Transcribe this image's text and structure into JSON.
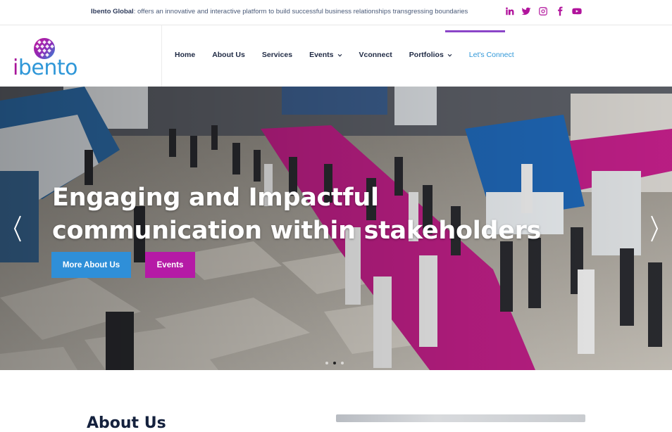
{
  "topbar": {
    "brand": "Ibento Global",
    "tagline": ": offers an innovative and interactive platform to build successful business relationships transgressing boundaries",
    "socials": [
      "linkedin-icon",
      "twitter-icon",
      "instagram-icon",
      "facebook-icon",
      "youtube-icon"
    ],
    "social_color": "#b1139c"
  },
  "logo": {
    "text_i": "i",
    "text_rest": "bento"
  },
  "nav": {
    "items": [
      {
        "label": "Home",
        "dropdown": false
      },
      {
        "label": "About Us",
        "dropdown": false
      },
      {
        "label": "Services",
        "dropdown": false
      },
      {
        "label": "Events",
        "dropdown": true
      },
      {
        "label": "Vconnect",
        "dropdown": false
      },
      {
        "label": "Portfolios",
        "dropdown": true
      },
      {
        "label": "Let's Connect",
        "dropdown": false,
        "active": true
      }
    ],
    "accent": "#8b45c8"
  },
  "hero": {
    "title_line1": "Engaging and Impactful",
    "title_line2": "communication within stakeholders",
    "primary_button": "More About Us",
    "secondary_button": "Events",
    "slides": 3,
    "active_slide": 2
  },
  "about": {
    "heading": "About Us"
  }
}
